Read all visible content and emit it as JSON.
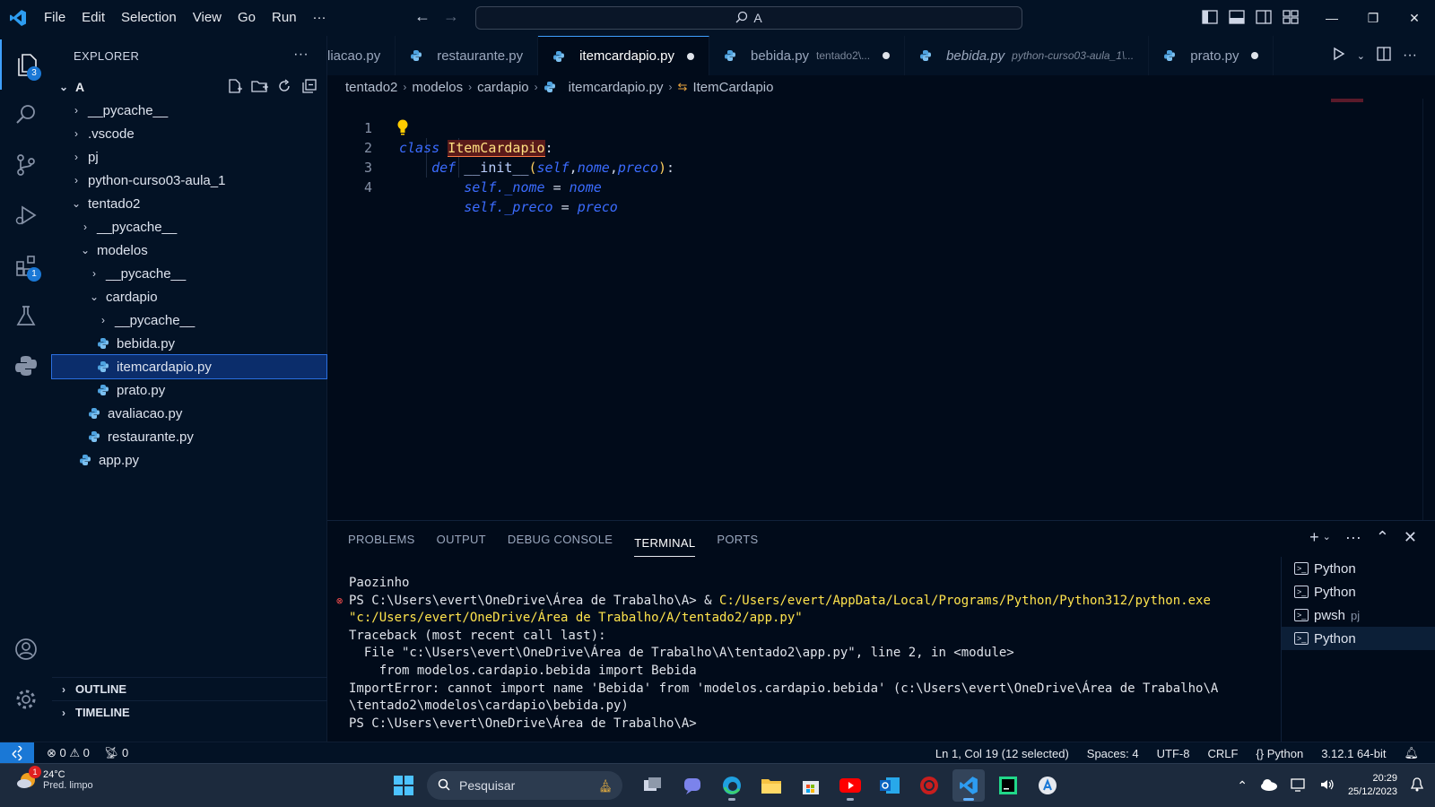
{
  "menu": [
    "File",
    "Edit",
    "Selection",
    "View",
    "Go",
    "Run",
    "···"
  ],
  "command_center": {
    "text": "A"
  },
  "activity_badges": {
    "explorer": "3",
    "extensions": "1"
  },
  "sidebar": {
    "title": "EXPLORER",
    "more": "···",
    "folder": "A",
    "items": [
      {
        "label": "__pycache__",
        "type": "folder",
        "open": false,
        "depth": 0
      },
      {
        "label": ".vscode",
        "type": "folder",
        "open": false,
        "depth": 0
      },
      {
        "label": "pj",
        "type": "folder",
        "open": false,
        "depth": 0
      },
      {
        "label": "python-curso03-aula_1",
        "type": "folder",
        "open": false,
        "depth": 0
      },
      {
        "label": "tentado2",
        "type": "folder",
        "open": true,
        "depth": 0
      },
      {
        "label": "__pycache__",
        "type": "folder",
        "open": false,
        "depth": 1
      },
      {
        "label": "modelos",
        "type": "folder",
        "open": true,
        "depth": 1
      },
      {
        "label": "__pycache__",
        "type": "folder",
        "open": false,
        "depth": 2
      },
      {
        "label": "cardapio",
        "type": "folder",
        "open": true,
        "depth": 2
      },
      {
        "label": "__pycache__",
        "type": "folder",
        "open": false,
        "depth": 3
      },
      {
        "label": "bebida.py",
        "type": "file",
        "depth": 3
      },
      {
        "label": "itemcardapio.py",
        "type": "file",
        "depth": 3,
        "selected": true
      },
      {
        "label": "prato.py",
        "type": "file",
        "depth": 3
      },
      {
        "label": "avaliacao.py",
        "type": "file",
        "depth": 2
      },
      {
        "label": "restaurante.py",
        "type": "file",
        "depth": 2
      },
      {
        "label": "app.py",
        "type": "file",
        "depth": 1
      }
    ],
    "outline": "OUTLINE",
    "timeline": "TIMELINE"
  },
  "tabs": [
    {
      "name": "liacao.py",
      "desc": "",
      "dirty": false,
      "active": false,
      "italic": false,
      "icon": false
    },
    {
      "name": "restaurante.py",
      "desc": "",
      "dirty": false,
      "active": false,
      "italic": false,
      "icon": true
    },
    {
      "name": "itemcardapio.py",
      "desc": "",
      "dirty": true,
      "active": true,
      "italic": false,
      "icon": true
    },
    {
      "name": "bebida.py",
      "desc": "tentado2\\...",
      "dirty": true,
      "active": false,
      "italic": false,
      "icon": true
    },
    {
      "name": "bebida.py",
      "desc": "python-curso03-aula_1\\...",
      "dirty": false,
      "active": false,
      "italic": true,
      "icon": true
    },
    {
      "name": "prato.py",
      "desc": "",
      "dirty": true,
      "active": false,
      "italic": false,
      "icon": true
    }
  ],
  "breadcrumb": [
    "tentado2",
    "modelos",
    "cardapio",
    "itemcardapio.py",
    "ItemCardapio"
  ],
  "code": {
    "line_numbers": [
      "1",
      "2",
      "3",
      "4"
    ],
    "l1_kw": "class",
    "l1_name": "ItemCardapio",
    "l1_colon": ":",
    "l2_kw": "def",
    "l2_fn": "__init__",
    "l2_open": "(",
    "l2_p1": "self",
    "l2_p2": "nome",
    "l2_p3": "preco",
    "l2_close": ")",
    "l2_colon": ":",
    "l3_self": "self",
    "l3_attr": "._nome",
    "l3_eq": " = ",
    "l3_val": "nome",
    "l4_self": "self",
    "l4_attr": "._preco",
    "l4_eq": " = ",
    "l4_val": "preco"
  },
  "panel": {
    "tabs": [
      "PROBLEMS",
      "OUTPUT",
      "DEBUG CONSOLE",
      "TERMINAL",
      "PORTS"
    ],
    "active_tab": "TERMINAL",
    "terminal_lines": {
      "l1": "Paozinho",
      "l2_prompt": "PS C:\\Users\\evert\\OneDrive\\Área de Trabalho\\A> & ",
      "l2_exe": "C:/Users/evert/AppData/Local/Programs/Python/Python312/python.exe",
      "l3": "\"c:/Users/evert/OneDrive/Área de Trabalho/A/tentado2/app.py\"",
      "l4": "Traceback (most recent call last):",
      "l5": "  File \"c:\\Users\\evert\\OneDrive\\Área de Trabalho\\A\\tentado2\\app.py\", line 2, in <module>",
      "l6": "    from modelos.cardapio.bebida import Bebida",
      "l7": "ImportError: cannot import name 'Bebida' from 'modelos.cardapio.bebida' (c:\\Users\\evert\\OneDrive\\Área de Trabalho\\A",
      "l8": "\\tentado2\\modelos\\cardapio\\bebida.py)",
      "l9": "PS C:\\Users\\evert\\OneDrive\\Área de Trabalho\\A> "
    },
    "terminals": [
      {
        "name": "Python",
        "sub": ""
      },
      {
        "name": "Python",
        "sub": ""
      },
      {
        "name": "pwsh",
        "sub": "pj"
      },
      {
        "name": "Python",
        "sub": "",
        "active": true
      }
    ]
  },
  "statusbar": {
    "errors": "0",
    "warnings": "0",
    "ports": "0",
    "position": "Ln 1, Col 19 (12 selected)",
    "spaces": "Spaces: 4",
    "encoding": "UTF-8",
    "eol": "CRLF",
    "language": "Python",
    "interpreter": "3.12.1 64-bit"
  },
  "taskbar": {
    "temp": "24°C",
    "condition": "Pred. limpo",
    "weather_badge": "1",
    "search": "Pesquisar",
    "time": "20:29",
    "date": "25/12/2023"
  },
  "colors": {
    "accent": "#3fa0ff",
    "badge": "#1a78d6",
    "selection": "#0b2d6b",
    "error": "#f14c4c",
    "path": "#ffe44d"
  }
}
